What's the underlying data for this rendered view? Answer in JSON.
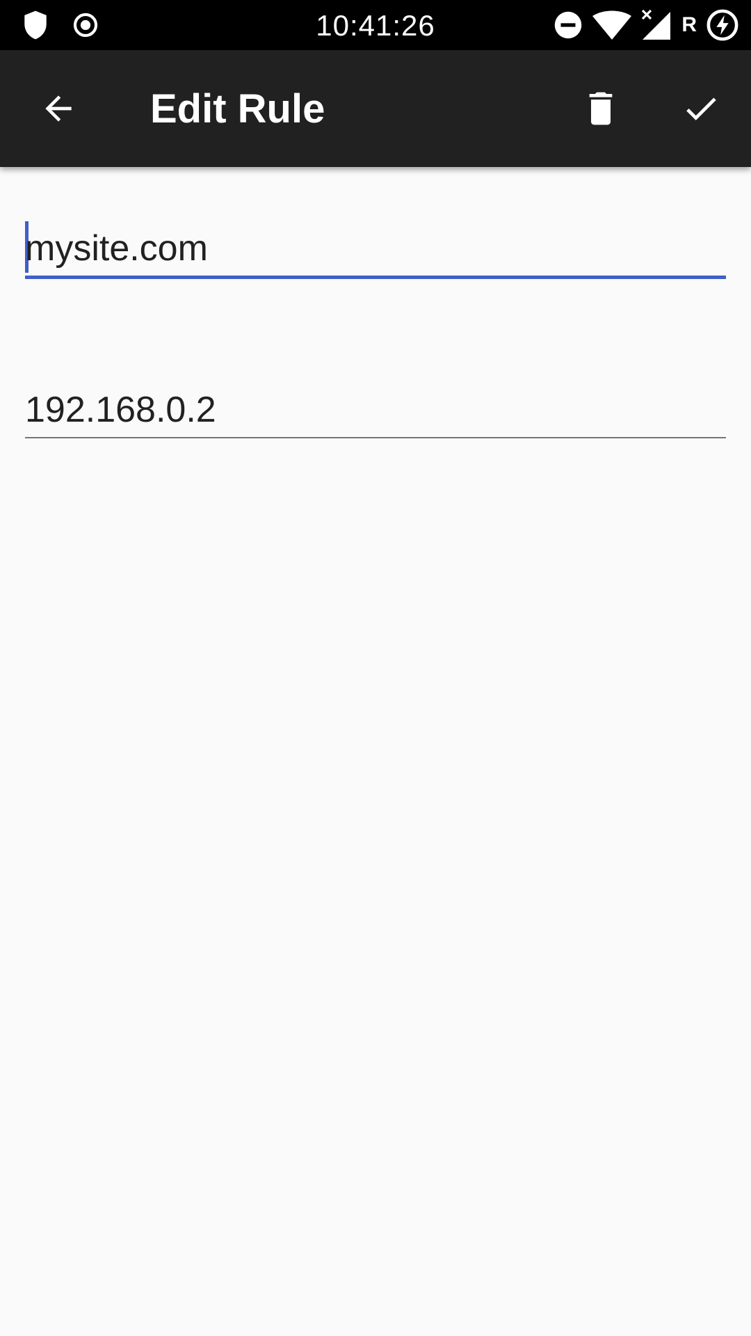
{
  "status_bar": {
    "time": "10:41:26",
    "left_icons": [
      "shield-icon",
      "target-icon"
    ],
    "right_icons": [
      "do-not-disturb-icon",
      "wifi-icon",
      "signal-no-service-icon",
      "roaming-icon",
      "battery-charging-icon"
    ],
    "roaming_letter": "R"
  },
  "app_bar": {
    "title": "Edit Rule",
    "back_icon": "arrow-back-icon",
    "actions": [
      "delete-icon",
      "check-icon"
    ]
  },
  "form": {
    "domain_value": "mysite.com",
    "ip_value": "192.168.0.2"
  },
  "colors": {
    "status_bar_bg": "#000000",
    "app_bar_bg": "#212121",
    "page_bg": "#fafafa",
    "accent": "#3f5fc8",
    "text": "#212121",
    "underline_inactive": "#757575"
  }
}
